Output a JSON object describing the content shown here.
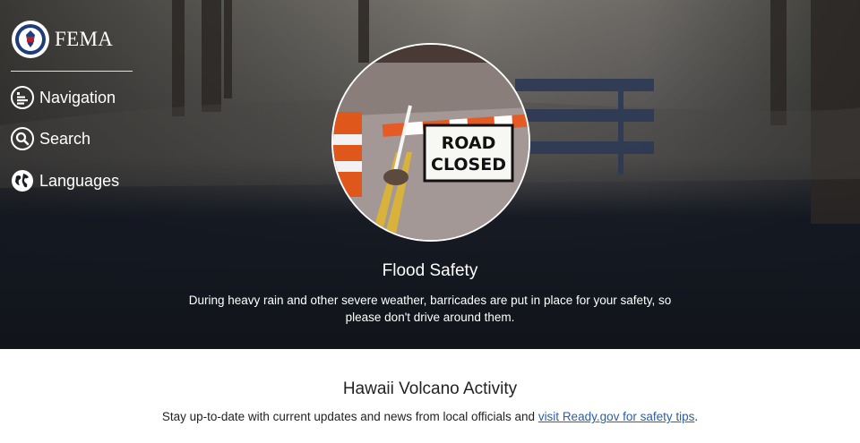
{
  "brand": {
    "name": "FEMA",
    "logo_icon": "dhs-seal-icon"
  },
  "nav": [
    {
      "label": "Navigation",
      "icon": "menu-lines-icon"
    },
    {
      "label": "Search",
      "icon": "search-icon"
    },
    {
      "label": "Languages",
      "icon": "globe-icon"
    }
  ],
  "hero": {
    "sign_line1": "ROAD",
    "sign_line2": "CLOSED",
    "title": "Flood Safety",
    "description": "During heavy rain and other severe weather, barricades are put in place for your safety, so please don't drive around them."
  },
  "section": {
    "title": "Hawaii Volcano Activity",
    "text": "Stay up-to-date with current updates and news from local officials and ",
    "link_text": "visit Ready.gov for safety tips",
    "text_end": "."
  },
  "colors": {
    "hero_dark": "#13171f",
    "link": "#2a5ea8",
    "text": "#222222"
  }
}
